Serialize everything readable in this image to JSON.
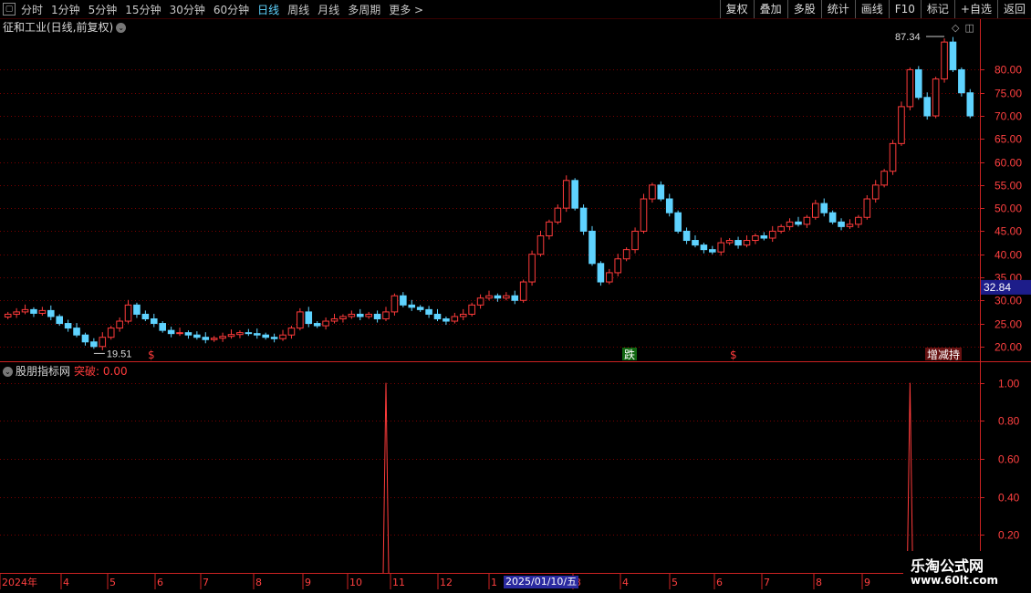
{
  "toolbar": {
    "periods": [
      "分时",
      "1分钟",
      "5分钟",
      "15分钟",
      "30分钟",
      "60分钟",
      "日线",
      "周线",
      "月线",
      "多周期",
      "更多 >"
    ],
    "active_period": "日线",
    "right_buttons": [
      "复权",
      "叠加",
      "多股",
      "统计",
      "画线",
      "F10",
      "标记",
      "+自选",
      "返回"
    ]
  },
  "main_title": "征和工业(日线,前复权)",
  "sub_title": {
    "name": "股朋指标网",
    "signal": "突破: 0.00"
  },
  "watermark": {
    "line1": "乐淘公式网",
    "line2": "www.60lt.com"
  },
  "colors": {
    "up": "#ff3b3b",
    "down": "#5fd3ff",
    "grid": "#7a0000",
    "axis": "#cc2222"
  },
  "chart_data": [
    {
      "type": "candlestick",
      "title": "征和工业(日线,前复权)",
      "y_ticks": [
        20.0,
        25.0,
        30.0,
        35.0,
        40.0,
        45.0,
        50.0,
        55.0,
        60.0,
        65.0,
        70.0,
        75.0,
        80.0
      ],
      "ylim": [
        17.0,
        88.0
      ],
      "current_price": "32.84",
      "annotations": {
        "high": "87.34",
        "low": "19.51"
      },
      "markers": [
        "$",
        "跌",
        "$",
        "增减持"
      ],
      "series": [
        {
          "name": "close",
          "values": [
            27.0,
            27.5,
            28.0,
            27.2,
            27.8,
            26.5,
            25.0,
            24.0,
            22.5,
            21.0,
            20.0,
            22.0,
            24.0,
            25.5,
            29.0,
            27.0,
            26.0,
            25.0,
            23.5,
            22.8,
            23.0,
            22.5,
            22.0,
            21.5,
            21.8,
            22.2,
            22.6,
            23.0,
            22.8,
            22.5,
            22.0,
            21.7,
            22.5,
            24.0,
            27.5,
            25.0,
            24.5,
            25.5,
            26.0,
            26.5,
            27.0,
            26.5,
            27.0,
            26.0,
            27.5,
            31.0,
            29.0,
            28.5,
            28.0,
            27.0,
            26.0,
            25.5,
            26.5,
            27.0,
            29.0,
            30.5,
            31.0,
            30.5,
            31.0,
            30.0,
            34.0,
            40.0,
            44.0,
            47.0,
            50.0,
            56.0,
            50.0,
            45.0,
            38.0,
            34.0,
            36.0,
            39.0,
            41.0,
            45.0,
            52.0,
            55.0,
            52.0,
            49.0,
            45.0,
            43.0,
            42.0,
            41.0,
            40.5,
            42.5,
            43.0,
            42.0,
            43.0,
            44.0,
            43.5,
            45.0,
            46.0,
            47.0,
            46.5,
            48.0,
            51.0,
            49.0,
            47.0,
            46.0,
            46.5,
            48.0,
            52.0,
            55.0,
            58.0,
            64.0,
            72.0,
            80.0,
            74.0,
            70.0,
            78.0,
            86.0,
            80.0,
            75.0,
            70.0
          ]
        }
      ]
    },
    {
      "type": "line",
      "title": "股朋指标网",
      "y_ticks": [
        0.2,
        0.4,
        0.6,
        0.8,
        1.0
      ],
      "ylim": [
        0.0,
        1.07
      ],
      "series": [
        {
          "name": "突破",
          "spikes": [
            {
              "index": 44,
              "value": 1.0
            },
            {
              "index": 105,
              "value": 1.0
            }
          ]
        }
      ]
    }
  ],
  "x_axis": {
    "labels": [
      "2024年",
      "4",
      "5",
      "6",
      "7",
      "8",
      "9",
      "10",
      "11",
      "12",
      "1",
      "3",
      "4",
      "5",
      "6",
      "7",
      "8",
      "9"
    ],
    "cursor_date": "2025/01/10/五"
  }
}
